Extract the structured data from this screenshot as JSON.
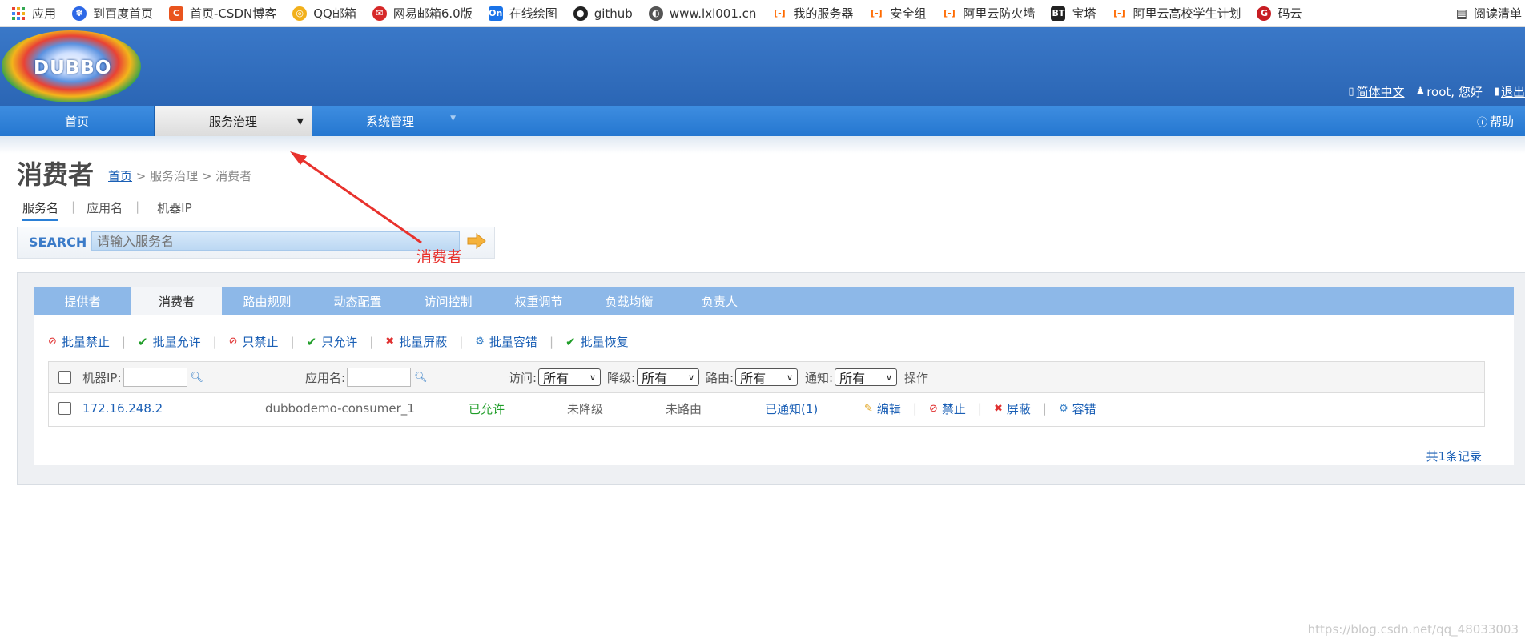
{
  "bookmarks": {
    "items": [
      {
        "label": "应用",
        "icon": "apps-grid-icon",
        "color": "#e94235"
      },
      {
        "label": "到百度首页",
        "icon": "baidu-paw-icon",
        "color": "#2d68e6"
      },
      {
        "label": "首页-CSDN博客",
        "icon": "csdn-icon",
        "color": "#e9541e"
      },
      {
        "label": "QQ邮箱",
        "icon": "qq-mail-icon",
        "color": "#f2b01b"
      },
      {
        "label": "网易邮箱6.0版",
        "icon": "netease-mail-icon",
        "color": "#d62828"
      },
      {
        "label": "在线绘图",
        "icon": "on-drawing-icon",
        "color": "#1a73e8"
      },
      {
        "label": "github",
        "icon": "github-icon",
        "color": "#222222"
      },
      {
        "label": "www.lxl001.cn",
        "icon": "globe-icon",
        "color": "#555555"
      },
      {
        "label": "我的服务器",
        "icon": "aliyun-icon",
        "color": "#ff6a00"
      },
      {
        "label": "安全组",
        "icon": "aliyun-icon",
        "color": "#ff6a00"
      },
      {
        "label": "阿里云防火墙",
        "icon": "aliyun-icon",
        "color": "#ff6a00"
      },
      {
        "label": "宝塔",
        "icon": "bt-icon",
        "color": "#222222"
      },
      {
        "label": "阿里云高校学生计划",
        "icon": "aliyun-icon",
        "color": "#ff6a00"
      },
      {
        "label": "码云",
        "icon": "gitee-icon",
        "color": "#c71d23"
      }
    ],
    "reading_list": "阅读清单"
  },
  "header": {
    "logo_text": "DUBBO",
    "language": "简体中文",
    "user": "root, 您好",
    "logout": "退出"
  },
  "nav": {
    "items": [
      "首页",
      "服务治理",
      "系统管理"
    ],
    "help": "帮助"
  },
  "page": {
    "title": "消费者",
    "breadcrumb": {
      "home": "首页",
      "rest": " > 服务治理 > 消费者"
    },
    "subtabs": [
      "服务名",
      "应用名",
      "机器IP"
    ],
    "search_label": "SEARCH",
    "search_placeholder": "请输入服务名",
    "annotation": "消费者"
  },
  "tabs": [
    "提供者",
    "消费者",
    "路由规则",
    "动态配置",
    "访问控制",
    "权重调节",
    "负载均衡",
    "负责人"
  ],
  "actions": [
    {
      "label": "批量禁止",
      "icon": "forbid-icon",
      "color": "#e03131"
    },
    {
      "label": "批量允许",
      "icon": "check-icon",
      "color": "#1f9d28"
    },
    {
      "label": "只禁止",
      "icon": "forbid-icon",
      "color": "#e03131"
    },
    {
      "label": "只允许",
      "icon": "check-icon",
      "color": "#1f9d28"
    },
    {
      "label": "批量屏蔽",
      "icon": "close-circle-icon",
      "color": "#e03131"
    },
    {
      "label": "批量容错",
      "icon": "gear-icon",
      "color": "#3b82c8"
    },
    {
      "label": "批量恢复",
      "icon": "check-icon",
      "color": "#1f9d28"
    }
  ],
  "table": {
    "header": {
      "ip_label": "机器IP:",
      "app_label": "应用名:",
      "access_label": "访问:",
      "access_value": "所有",
      "degrade_label": "降级:",
      "degrade_value": "所有",
      "route_label": "路由:",
      "route_value": "所有",
      "notify_label": "通知:",
      "notify_value": "所有",
      "ops_label": "操作"
    },
    "rows": [
      {
        "ip": "172.16.248.2",
        "app": "dubbodemo-consumer_1",
        "access": "已允许",
        "degrade": "未降级",
        "route": "未路由",
        "notify": "已通知(1)",
        "ops": [
          "编辑",
          "禁止",
          "屏蔽",
          "容错"
        ]
      }
    ]
  },
  "footer": {
    "total": "共1条记录"
  },
  "watermark": "https://blog.csdn.net/qq_48033003"
}
